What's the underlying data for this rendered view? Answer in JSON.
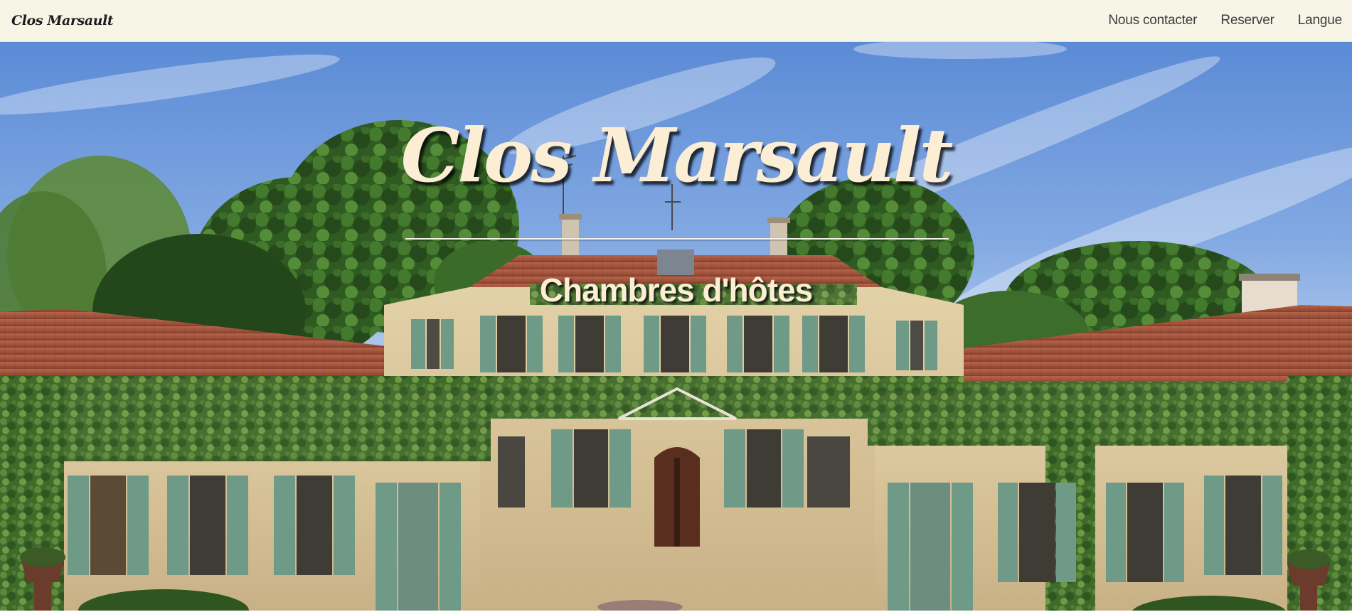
{
  "navbar": {
    "brand": "Clos Marsault",
    "links": [
      {
        "label": "Nous contacter"
      },
      {
        "label": "Reserver"
      },
      {
        "label": "Langue"
      }
    ]
  },
  "hero": {
    "title": "Clos Marsault",
    "subtitle": "Chambres d'hôtes",
    "image": "stone manor house with green shutters, ivy and terracotta roof under blue sky"
  },
  "colors": {
    "navbar_bg": "#f7f5e6",
    "hero_text": "#fbeed4",
    "shutter_green": "#6f9a87",
    "roof_terracotta": "#a4543b",
    "stone": "#d7c29a"
  }
}
